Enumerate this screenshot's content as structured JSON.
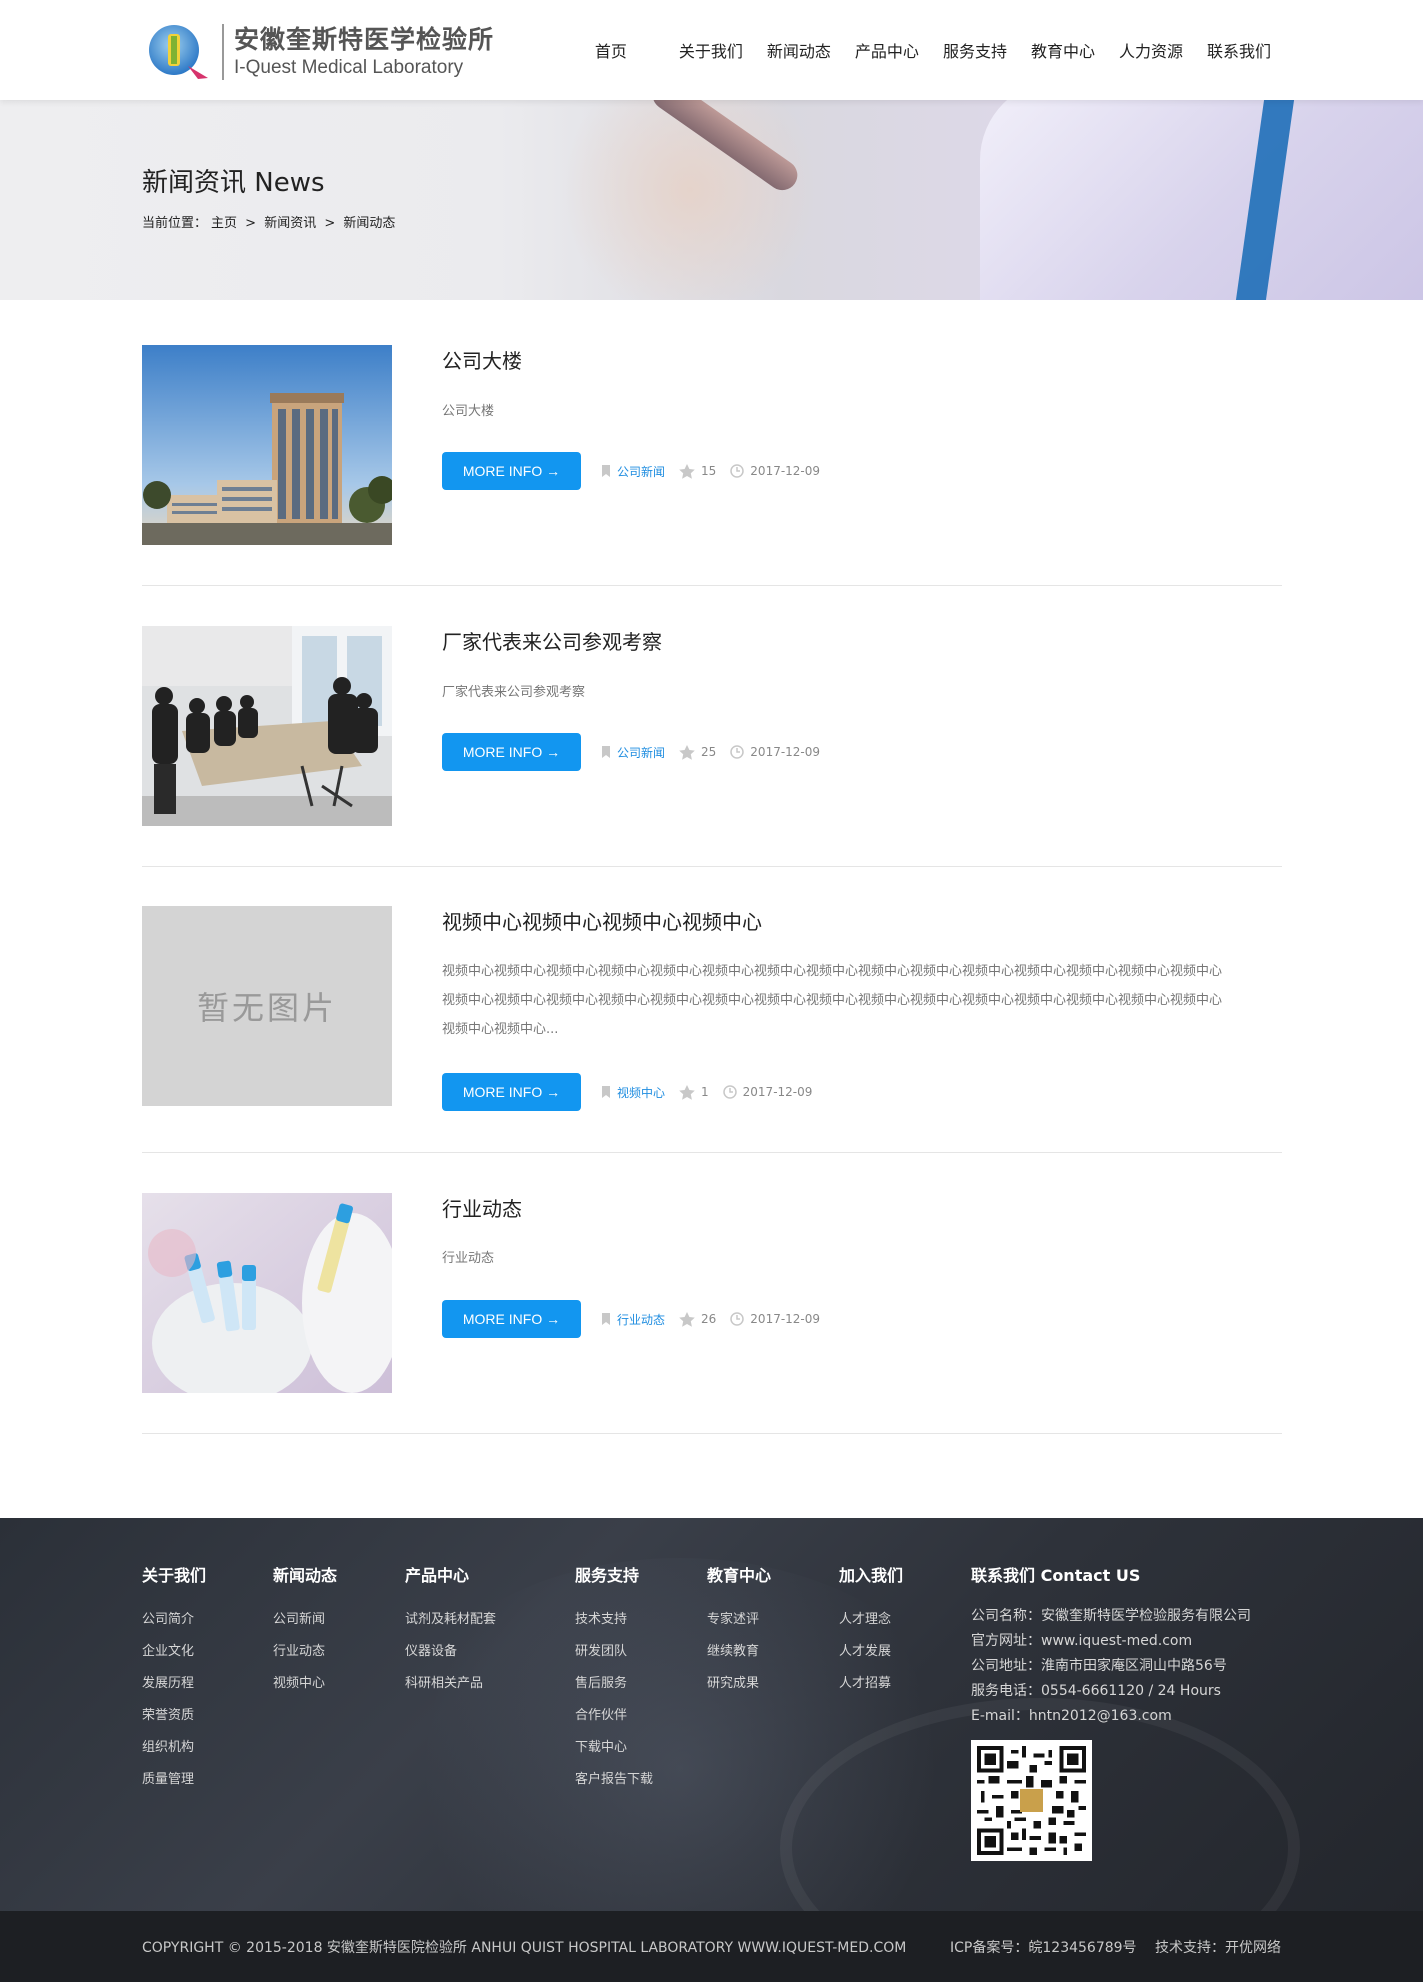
{
  "brand": {
    "name_cn": "安徽奎斯特医学检验所",
    "name_en": "I-Quest Medical Laboratory",
    "colors": {
      "primary_blue": "#1296f0",
      "logo_green": "#7fb233",
      "logo_blue": "#2d79c7"
    }
  },
  "nav": {
    "items": [
      "首页",
      "关于我们",
      "新闻动态",
      "产品中心",
      "服务支持",
      "教育中心",
      "人力资源",
      "联系我们"
    ]
  },
  "banner": {
    "title": "新闻资讯 News",
    "breadcrumb": {
      "prefix": "当前位置：",
      "items": [
        "主页",
        ">",
        "新闻资讯",
        ">",
        "新闻动态"
      ]
    }
  },
  "news": {
    "button_label": "MORE INFO →",
    "placeholder_text": "暂无图片",
    "items": [
      {
        "title": "公司大楼",
        "summary": "公司大楼",
        "category": "公司新闻",
        "views": "15",
        "date": "2017-12-09",
        "image": "building"
      },
      {
        "title": "厂家代表来公司参观考察",
        "summary": "厂家代表来公司参观考察",
        "category": "公司新闻",
        "views": "25",
        "date": "2017-12-09",
        "image": "meeting"
      },
      {
        "title": "视频中心视频中心视频中心视频中心",
        "summary_lines": [
          "视频中心视频中心视频中心视频中心视频中心视频中心视频中心视频中心视频中心视频中心视频中心视频中心视频中心视频中心视频中心",
          "视频中心视频中心视频中心视频中心视频中心视频中心视频中心视频中心视频中心视频中心视频中心视频中心视频中心视频中心视频中心",
          "视频中心视频中心..."
        ],
        "category": "视频中心",
        "views": "1",
        "date": "2017-12-09",
        "image": "none"
      },
      {
        "title": "行业动态",
        "summary": "行业动态",
        "category": "行业动态",
        "views": "26",
        "date": "2017-12-09",
        "image": "tubes"
      }
    ]
  },
  "footer": {
    "columns": [
      {
        "title": "关于我们",
        "links": [
          "公司简介",
          "企业文化",
          "发展历程",
          "荣誉资质",
          "组织机构",
          "质量管理"
        ]
      },
      {
        "title": "新闻动态",
        "links": [
          "公司新闻",
          "行业动态",
          "视频中心"
        ]
      },
      {
        "title": "产品中心",
        "links": [
          "试剂及耗材配套",
          "仪器设备",
          "科研相关产品"
        ]
      },
      {
        "title": "服务支持",
        "links": [
          "技术支持",
          "研发团队",
          "售后服务",
          "合作伙伴",
          "下载中心",
          "客户报告下载"
        ]
      },
      {
        "title": "教育中心",
        "links": [
          "专家述评",
          "继续教育",
          "研究成果"
        ]
      },
      {
        "title": "加入我们",
        "links": [
          "人才理念",
          "人才发展",
          "人才招募"
        ]
      }
    ],
    "contact": {
      "title": "联系我们 Contact US",
      "lines": [
        "公司名称：安徽奎斯特医学检验服务有限公司",
        "官方网址：www.iquest-med.com",
        "公司地址：淮南市田家庵区洞山中路56号",
        "服务电话：0554-6661120 / 24 Hours",
        "E-mail：hntn2012@163.com"
      ]
    },
    "copyright": "COPYRIGHT © 2015-2018 安徽奎斯特医院检验所 ANHUI QUIST HOSPITAL LABORATORY WWW.IQUEST-MED.COM",
    "icp": "ICP备案号：皖123456789号",
    "tech_support": "技术支持：开优网络"
  }
}
